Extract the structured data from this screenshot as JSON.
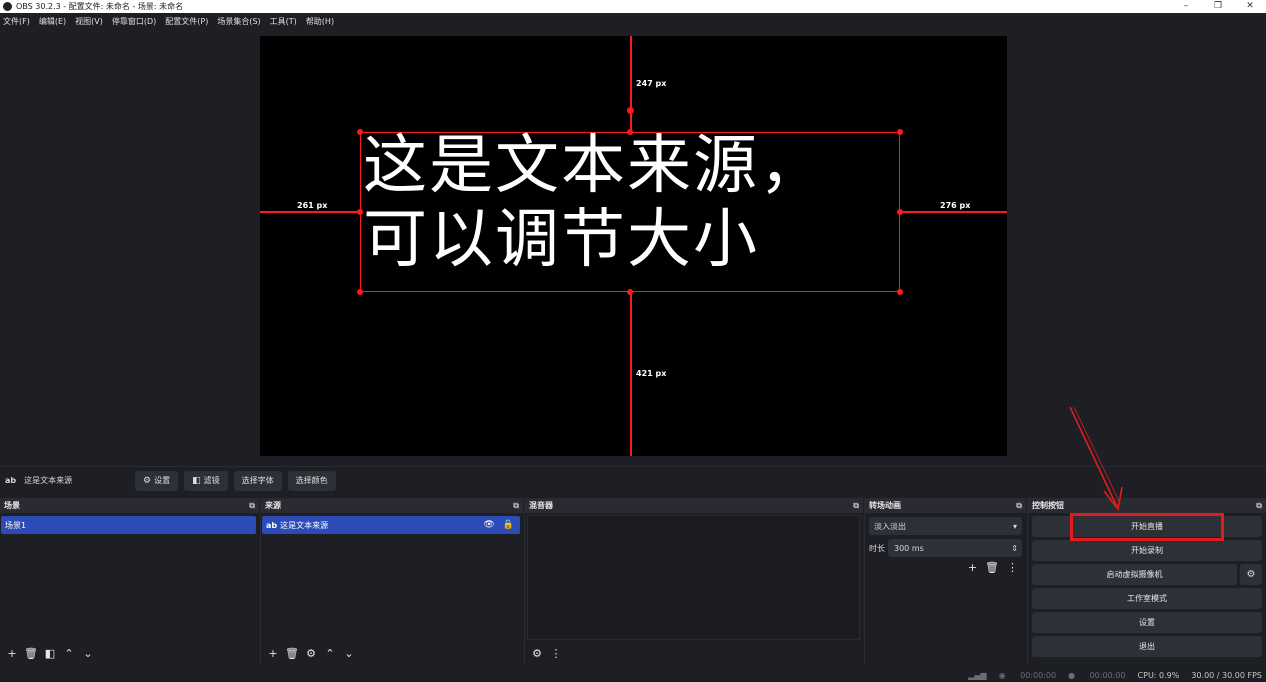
{
  "window": {
    "title": "OBS 30.2.3 - 配置文件: 未命名 - 场景: 未命名",
    "minimize": "–",
    "maximize": "❐",
    "close": "✕"
  },
  "menu": [
    "文件(F)",
    "编辑(E)",
    "视图(V)",
    "停靠窗口(D)",
    "配置文件(P)",
    "场景集合(S)",
    "工具(T)",
    "帮助(H)"
  ],
  "preview": {
    "source_line1": "这是文本来源，",
    "source_line2": "可以调节大小",
    "dist_top": "247 px",
    "dist_left": "261 px",
    "dist_right": "276 px",
    "dist_bottom": "421 px"
  },
  "context_bar": {
    "source_name": "这是文本来源",
    "settings": "设置",
    "filters": "滤镜",
    "select_font": "选择字体",
    "select_color": "选择颜色"
  },
  "docks": {
    "scenes": {
      "title": "场景",
      "items": [
        "场景1"
      ]
    },
    "sources": {
      "title": "来源",
      "items": [
        "这是文本来源"
      ]
    },
    "mixer": {
      "title": "混音器"
    },
    "transitions": {
      "title": "转场动画",
      "selected": "淡入淡出",
      "duration_label": "时长",
      "duration_value": "300 ms"
    },
    "controls": {
      "title": "控制按钮",
      "start_stream": "开始直播",
      "start_record": "开始录制",
      "virtual_cam": "启动虚拟摄像机",
      "studio_mode": "工作室模式",
      "settings": "设置",
      "exit": "退出"
    }
  },
  "status": {
    "stream_time": "00:00:00",
    "record_time": "00:00:00",
    "cpu": "CPU: 0.9%",
    "fps": "30.00 / 30.00 FPS"
  },
  "colors": {
    "selected_row": "#2d4bb6",
    "guide_red": "#ff1a1a",
    "annotation_red": "#e01c1c"
  }
}
